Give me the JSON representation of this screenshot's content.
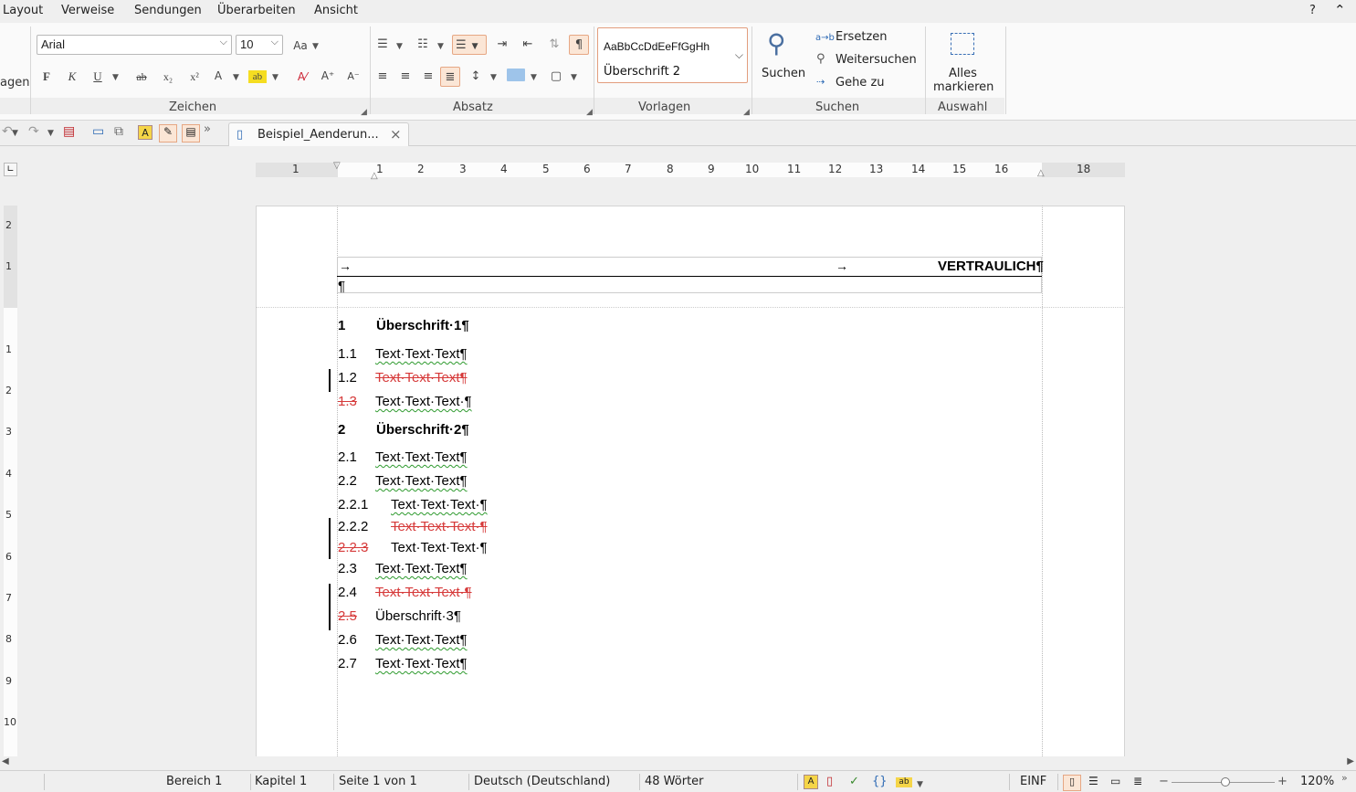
{
  "menubar": {
    "items": [
      "Layout",
      "Verweise",
      "Sendungen",
      "Überarbeiten",
      "Ansicht"
    ],
    "help": "?",
    "collapse": "^"
  },
  "ribbon": {
    "clipped_label": "agen",
    "font_name": "Arial",
    "font_size": "10",
    "groups": {
      "zeichen": "Zeichen",
      "absatz": "Absatz",
      "vorlagen": "Vorlagen",
      "suchen": "Suchen",
      "auswahl": "Auswahl"
    },
    "format_buttons": {
      "bold": "F",
      "italic": "K",
      "underline": "U",
      "strike": "ab",
      "sub": "x₂",
      "sup": "x²",
      "fontcolor": "A",
      "grow": "A",
      "shrink": "A",
      "highlight": "ab"
    },
    "style_preview": "AaBbCcDdEeFfGgHh",
    "style_name": "Überschrift 2",
    "search_label": "Suchen",
    "replace_label": "Ersetzen",
    "find_next_label": "Weitersuchen",
    "goto_label": "Gehe zu",
    "select_all_line1": "Alles",
    "select_all_line2": "markieren"
  },
  "tab": {
    "title": "Beispiel_Aenderun...",
    "close": "×"
  },
  "ruler": {
    "h_marks": [
      "1",
      "1",
      "2",
      "3",
      "4",
      "5",
      "6",
      "7",
      "8",
      "9",
      "10",
      "11",
      "12",
      "13",
      "14",
      "15",
      "16",
      "18"
    ],
    "v_marks": [
      "2",
      "1",
      "1",
      "2",
      "3",
      "4",
      "5",
      "6",
      "7",
      "8",
      "9",
      "10"
    ]
  },
  "document": {
    "header": {
      "arrow1": "→",
      "arrow2": "→",
      "text": "VERTRAULICH¶",
      "empty_para": "¶"
    },
    "lines": [
      {
        "num": "1",
        "text": "Überschrift·1¶",
        "kind": "h1"
      },
      {
        "num": "1.1",
        "text": "Text·Text·Text¶",
        "kind": "normal"
      },
      {
        "num": "1.2",
        "text": "Text·Text·Text¶",
        "kind": "deleted"
      },
      {
        "num": "1.3",
        "text": "Text·Text·Text·¶",
        "kind": "numdeleted"
      },
      {
        "num": "2",
        "text": "Überschrift·2¶",
        "kind": "h1"
      },
      {
        "num": "2.1",
        "text": "Text·Text·Text¶",
        "kind": "normal"
      },
      {
        "num": "2.2",
        "text": "Text·Text·Text¶",
        "kind": "normal"
      },
      {
        "num": "2.2.1",
        "text": "Text·Text·Text·¶",
        "kind": "normal3"
      },
      {
        "num": "2.2.2",
        "text": "Text·Text·Text·¶",
        "kind": "deleted3"
      },
      {
        "num": "2.2.3",
        "text": "Text·Text·Text·¶",
        "kind": "numdeleted3"
      },
      {
        "num": "2.3",
        "text": "Text·Text·Text¶",
        "kind": "normal"
      },
      {
        "num": "2.4",
        "text": "Text·Text·Text·¶",
        "kind": "deleted"
      },
      {
        "num": "2.5",
        "text": "Überschrift·3¶",
        "kind": "numdeleted_plain"
      },
      {
        "num": "2.6",
        "text": "Text·Text·Text¶",
        "kind": "normal"
      },
      {
        "num": "2.7",
        "text": "Text·Text·Text¶",
        "kind": "normal"
      }
    ]
  },
  "status": {
    "bereich": "Bereich 1",
    "kapitel": "Kapitel 1",
    "seite": "Seite 1 von 1",
    "sprache": "Deutsch (Deutschland)",
    "woerter": "48 Wörter",
    "mode": "EINF",
    "zoom": "120%",
    "zoom_minus": "−",
    "zoom_plus": "+"
  }
}
